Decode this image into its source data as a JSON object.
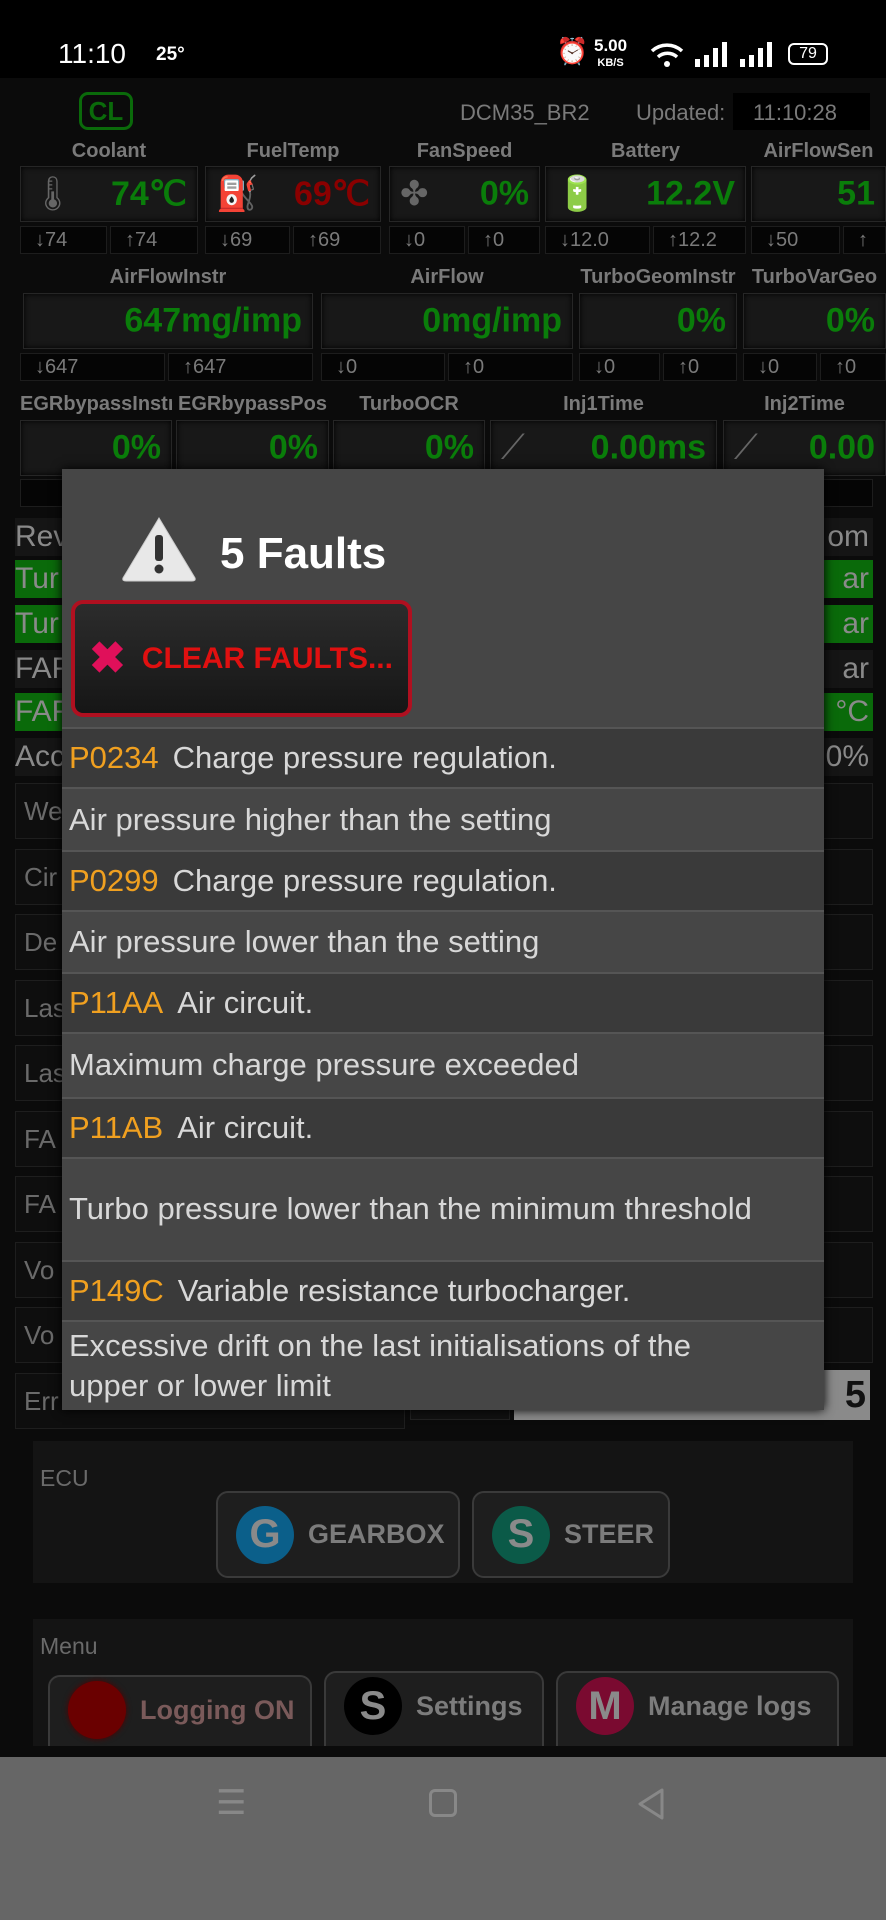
{
  "status_bar": {
    "time": "11:10",
    "temperature": "25°",
    "net_speed": "5.00",
    "net_unit": "KB/S",
    "battery": "79"
  },
  "header": {
    "badge": "CL",
    "device": "DCM35_BR2",
    "updated_label": "Updated:",
    "updated_time": "11:10:28"
  },
  "gauges_row1": [
    {
      "label": "Coolant",
      "value": "74℃",
      "icon": "thermometer-icon",
      "min": "↓74",
      "max": "↑74",
      "color": "#0a7d0a"
    },
    {
      "label": "FuelTemp",
      "value": "69℃",
      "icon": "fuel-pump-icon",
      "min": "↓69",
      "max": "↑69",
      "color": "#8a0000"
    },
    {
      "label": "FanSpeed",
      "value": "0%",
      "icon": "fan-icon",
      "min": "↓0",
      "max": "↑0",
      "color": "#0a7d0a"
    },
    {
      "label": "Battery",
      "value": "12.2V",
      "icon": "battery-icon",
      "min": "↓12.0",
      "max": "↑12.2",
      "color": "#0a7d0a"
    },
    {
      "label": "AirFlowSen",
      "value": "51",
      "icon": "",
      "min": "↓50",
      "max": "↑",
      "color": "#0a7d0a"
    }
  ],
  "gauges_row2": [
    {
      "label": "AirFlowInstr",
      "value": "647mg/imp",
      "min": "↓647",
      "max": "↑647"
    },
    {
      "label": "AirFlow",
      "value": "0mg/imp",
      "min": "↓0",
      "max": "↑0"
    },
    {
      "label": "TurboGeomInstr",
      "value": "0%",
      "min": "↓0",
      "max": "↑0"
    },
    {
      "label": "TurboVarGeo",
      "value": "0%",
      "min": "↓0",
      "max": "↑0"
    }
  ],
  "gauges_row3": [
    {
      "label": "EGRbypassInstr",
      "value": "0%",
      "icon": ""
    },
    {
      "label": "EGRbypassPos",
      "value": "0%",
      "icon": ""
    },
    {
      "label": "TurboOCR",
      "value": "0%",
      "icon": ""
    },
    {
      "label": "Inj1Time",
      "value": "0.00ms",
      "icon": "injector-icon"
    },
    {
      "label": "Inj2Time",
      "value": "0.00",
      "icon": "injector-icon"
    }
  ],
  "background_rows": [
    {
      "left": "Rev",
      "right": "om",
      "green": false
    },
    {
      "left": "Tur",
      "right": "ar",
      "green": true
    },
    {
      "left": "Tur",
      "right": "ar",
      "green": true
    },
    {
      "left": "FAF",
      "right": "ar",
      "green": false
    },
    {
      "left": "FAF",
      "right": "°C",
      "green": true
    },
    {
      "left": "Acc",
      "right": "0%",
      "green": false
    }
  ],
  "background_boxes": [
    "We",
    "Cir",
    "De",
    "Las",
    "Las",
    "FA",
    "FA",
    "Vo",
    "Vo",
    "Err"
  ],
  "error_count_value": "5",
  "dialog": {
    "title": "5 Faults",
    "clear_button": "CLEAR FAULTS...",
    "faults": [
      {
        "code": "P0234",
        "title": "Charge pressure regulation.",
        "description": "Air pressure higher than the setting"
      },
      {
        "code": "P0299",
        "title": "Charge pressure regulation.",
        "description": "Air pressure lower than the setting"
      },
      {
        "code": "P11AA",
        "title": "Air circuit.",
        "description": "Maximum charge pressure exceeded"
      },
      {
        "code": "P11AB",
        "title": "Air circuit.",
        "description": "Turbo pressure lower than the minimum threshold"
      },
      {
        "code": "P149C",
        "title": "Variable resistance turbocharger.",
        "description": "Excessive drift on the last initialisations of the upper or lower limit"
      }
    ]
  },
  "ecu": {
    "label": "ECU",
    "buttons": [
      {
        "letter": "G",
        "label": "GEARBOX",
        "color": "#0b5f8a"
      },
      {
        "letter": "S",
        "label": "STEER",
        "color": "#0b5a48"
      }
    ]
  },
  "menu": {
    "label": "Menu",
    "buttons": [
      {
        "letter": "",
        "label": "Logging  ON",
        "color": "#6a0000"
      },
      {
        "letter": "S",
        "label": "Settings",
        "color": "#000000"
      },
      {
        "letter": "M",
        "label": "Manage logs",
        "color": "#7a0a30"
      }
    ]
  }
}
